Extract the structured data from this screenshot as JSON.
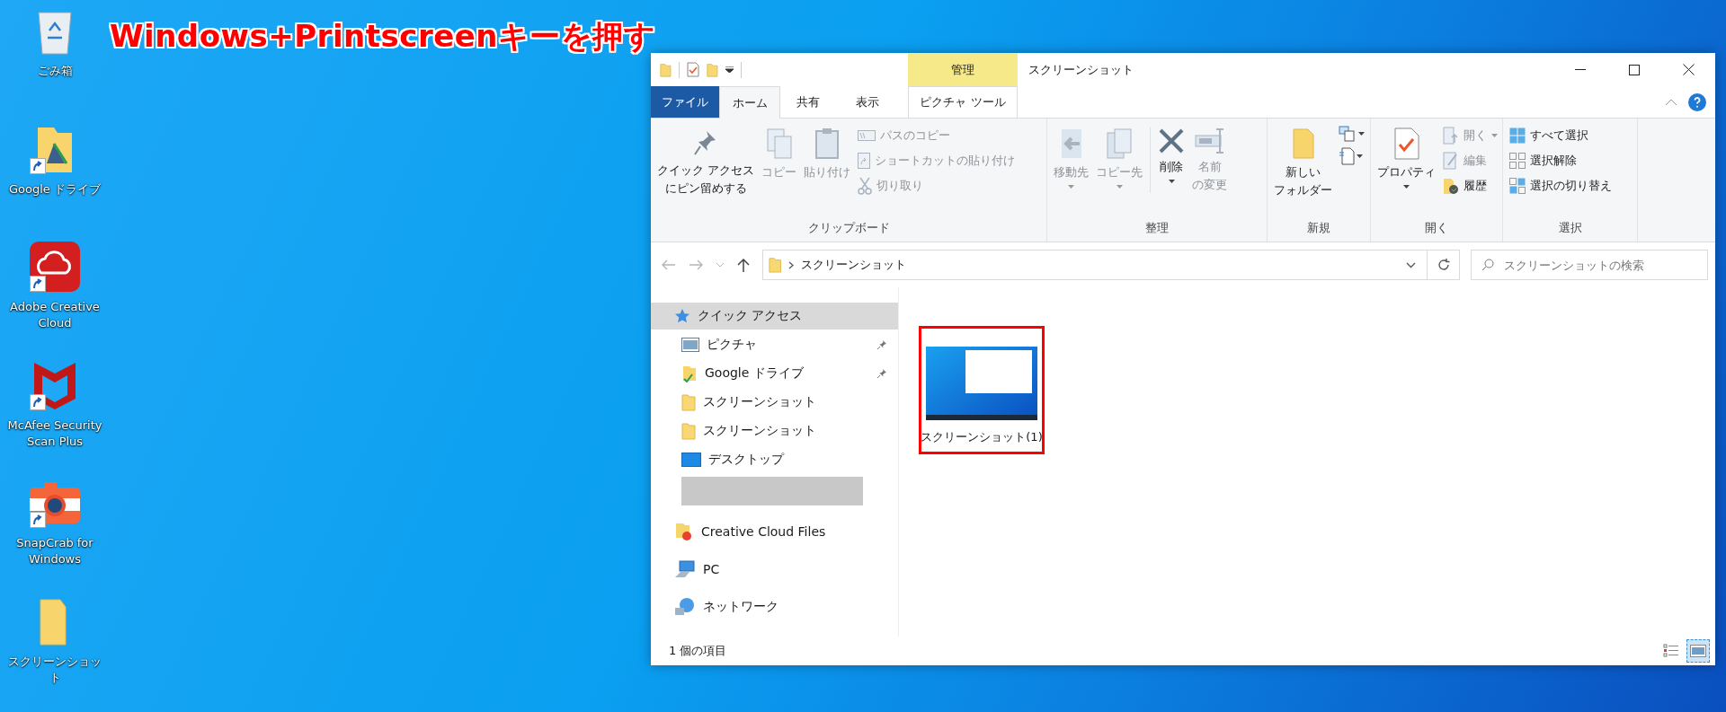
{
  "annotation": "Windows+Printscreenキーを押す",
  "desktop_icons": [
    {
      "label": "ごみ箱",
      "kind": "recycle",
      "shortcut": false
    },
    {
      "label": "Google ドライブ",
      "kind": "drive",
      "shortcut": true
    },
    {
      "label": "Adobe Creative Cloud",
      "kind": "adobe",
      "shortcut": true
    },
    {
      "label": "McAfee Security Scan Plus",
      "kind": "mcafee",
      "shortcut": true
    },
    {
      "label": "SnapCrab for Windows",
      "kind": "camera",
      "shortcut": true
    },
    {
      "label": "スクリーンショット",
      "kind": "folder",
      "shortcut": false
    }
  ],
  "window": {
    "title": "スクリーンショット",
    "context_header": "管理",
    "tabs": [
      {
        "label": "ファイル",
        "kind": "file",
        "selected": false
      },
      {
        "label": "ホーム",
        "kind": "tab",
        "selected": true
      },
      {
        "label": "共有",
        "kind": "tab",
        "selected": false
      },
      {
        "label": "表示",
        "kind": "tab",
        "selected": false
      },
      {
        "label": "ピクチャ ツール",
        "kind": "context",
        "selected": false
      }
    ]
  },
  "ribbon": {
    "groups": [
      {
        "label": "クリップボード",
        "commands": [
          {
            "lines": [
              "クイック アクセス",
              "にピン留めする"
            ],
            "kind": "large",
            "disabled": false,
            "dropdown": false
          },
          {
            "label": "コピー",
            "kind": "large",
            "disabled": true,
            "dropdown": false
          },
          {
            "label": "貼り付け",
            "kind": "large",
            "disabled": true,
            "dropdown": false
          },
          {
            "label": "パスのコピー",
            "kind": "small",
            "disabled": true,
            "dropdown": false
          },
          {
            "label": "ショートカットの貼り付け",
            "kind": "small",
            "disabled": true,
            "dropdown": false
          },
          {
            "label": "切り取り",
            "kind": "small",
            "disabled": true,
            "dropdown": false
          }
        ]
      },
      {
        "label": "整理",
        "commands": [
          {
            "label": "移動先",
            "kind": "large",
            "disabled": true,
            "dropdown": true
          },
          {
            "label": "コピー先",
            "kind": "large",
            "disabled": true,
            "dropdown": true
          },
          {
            "label": "削除",
            "kind": "large",
            "disabled": false,
            "dropdown": true
          },
          {
            "lines": [
              "名前",
              "の変更"
            ],
            "kind": "large",
            "disabled": true,
            "dropdown": false
          }
        ]
      },
      {
        "label": "新規",
        "commands": [
          {
            "lines": [
              "新しい",
              "フォルダー"
            ],
            "kind": "large",
            "disabled": false,
            "dropdown": false
          },
          {
            "kind": "icon",
            "disabled": false,
            "dropdown": true
          },
          {
            "kind": "icon",
            "disabled": false,
            "dropdown": true
          }
        ]
      },
      {
        "label": "開く",
        "commands": [
          {
            "label": "プロパティ",
            "kind": "large",
            "disabled": false,
            "dropdown": true
          },
          {
            "label": "開く",
            "kind": "small",
            "disabled": true,
            "dropdown": true
          },
          {
            "label": "編集",
            "kind": "small",
            "disabled": true,
            "dropdown": false
          },
          {
            "label": "履歴",
            "kind": "small",
            "disabled": false,
            "dropdown": false
          }
        ]
      },
      {
        "label": "選択",
        "commands": [
          {
            "label": "すべて選択",
            "kind": "small",
            "disabled": false,
            "dropdown": false
          },
          {
            "label": "選択解除",
            "kind": "small",
            "disabled": false,
            "dropdown": false
          },
          {
            "label": "選択の切り替え",
            "kind": "small",
            "disabled": false,
            "dropdown": false
          }
        ]
      }
    ]
  },
  "nav_buttons": [
    {
      "kind": "back",
      "disabled": true
    },
    {
      "kind": "forward",
      "disabled": true
    },
    {
      "kind": "recent",
      "disabled": true
    },
    {
      "kind": "up",
      "disabled": false
    }
  ],
  "address": {
    "path": "スクリーンショット"
  },
  "search": {
    "placeholder": "スクリーンショットの検索"
  },
  "nav_pane": {
    "items": [
      {
        "label": "クイック アクセス",
        "kind": "star",
        "selected": true,
        "pinned": false,
        "children": [
          {
            "label": "ピクチャ",
            "kind": "pictures",
            "selected": false,
            "pinned": true
          },
          {
            "label": "Google ドライブ",
            "kind": "drive",
            "selected": false,
            "pinned": true
          },
          {
            "label": "スクリーンショット",
            "kind": "folder",
            "selected": false,
            "pinned": false
          },
          {
            "label": "スクリーンショット",
            "kind": "folder",
            "selected": false,
            "pinned": false
          },
          {
            "label": "デスクトップ",
            "kind": "desktop",
            "selected": false,
            "pinned": false
          },
          {
            "kind": "redacted",
            "selected": false,
            "pinned": false
          }
        ]
      },
      {
        "label": "Creative Cloud Files",
        "kind": "cloud",
        "selected": false,
        "pinned": false
      },
      {
        "label": "PC",
        "kind": "pc",
        "selected": false,
        "pinned": false
      },
      {
        "label": "ネットワーク",
        "kind": "network",
        "selected": false,
        "pinned": false
      }
    ]
  },
  "files": [
    {
      "name": "スクリーンショット(1)",
      "highlighted": true
    }
  ],
  "status_bar": {
    "text": "1 個の項目",
    "views": [
      {
        "kind": "details",
        "selected": false
      },
      {
        "kind": "large_icons",
        "selected": true
      }
    ]
  }
}
